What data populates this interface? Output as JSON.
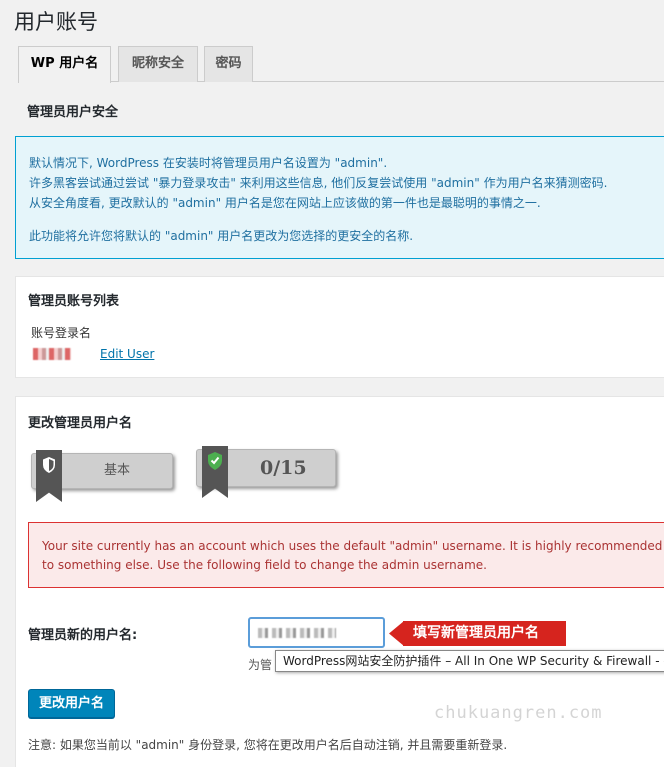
{
  "page": {
    "title": "用户账号"
  },
  "tabs": [
    {
      "label": "WP 用户名",
      "active": true
    },
    {
      "label": "昵称安全",
      "active": false
    },
    {
      "label": "密码",
      "active": false
    }
  ],
  "section": {
    "heading": "管理员用户安全"
  },
  "info": {
    "line1": "默认情况下, WordPress 在安装时将管理员用户名设置为 \"admin\".",
    "line2": "许多黑客尝试通过尝试 \"暴力登录攻击\" 来利用这些信息, 他们反复尝试使用 \"admin\" 作为用户名来猜测密码.",
    "line3": "从安全角度看, 更改默认的 \"admin\" 用户名是您在网站上应该做的第一件也是最聪明的事情之一.",
    "line4": "此功能将允许您将默认的 \"admin\" 用户名更改为您选择的更安全的名称."
  },
  "admin_list": {
    "title": "管理员账号列表",
    "column": "账号登录名",
    "edit_link": "Edit User"
  },
  "change_box": {
    "title": "更改管理员用户名",
    "badge_level": "基本",
    "badge_score": "0/15"
  },
  "alert": {
    "line1": "Your site currently has an account which uses the default \"admin\" username. It is highly recommended that y",
    "line2": "to something else. Use the following field to change the admin username."
  },
  "form": {
    "label": "管理员新的用户名:",
    "callout": "填写新管理员用户名",
    "help_prefix": "为管",
    "tooltip": "WordPress网站安全防护插件 – All In One WP Security & Firewall - 排",
    "submit_label": "更改用户名",
    "note": "注意: 如果您当前以 \"admin\" 身份登录, 您将在更改用户名后自动注销, 并且需要重新登录."
  },
  "watermark": "chukuangren.com",
  "colors": {
    "accent": "#0085ba",
    "alert_border": "#dc3232",
    "info_border": "#00a0d2",
    "callout": "#d6241e"
  }
}
